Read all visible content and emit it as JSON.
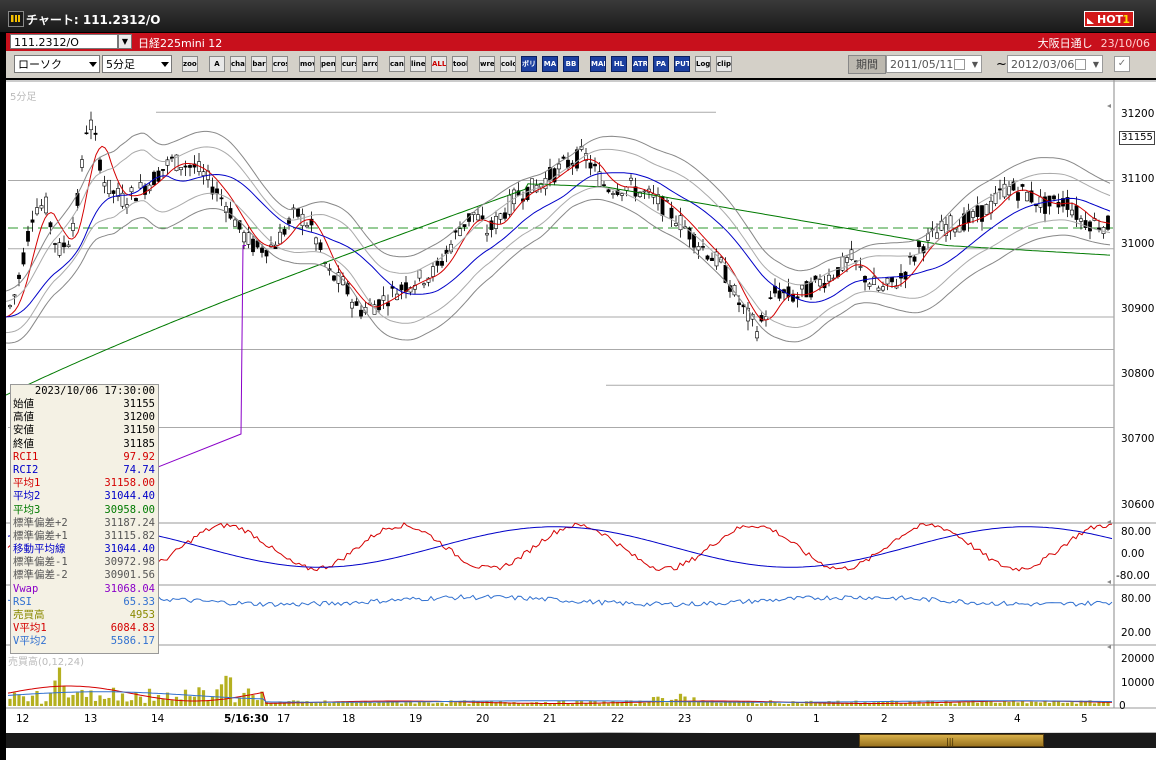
{
  "window": {
    "title": "チャート: 111.2312/O",
    "hot_label": "HOT",
    "hot_num": "1"
  },
  "symbol_bar": {
    "symbol": "111.2312/O",
    "name": "日経225mini 12",
    "exchange": "大阪日通し",
    "date": "23/10/06"
  },
  "toolbar": {
    "chart_type": "ローソク",
    "interval": "5分足",
    "buttons": [
      "zoom",
      "A",
      "chart",
      "bar",
      "cross",
      "move",
      "pen",
      "cursor",
      "arrow",
      "candle",
      "line",
      "ALL",
      "tool",
      "wrench",
      "color",
      "ボリ",
      "MA",
      "BB",
      "MAE",
      "HL",
      "ATR",
      "PA",
      "PUT",
      "Log",
      "clip"
    ],
    "period_label": "期間",
    "date_from": "2011/05/11",
    "date_to": "2012/03/06",
    "tilde": "~"
  },
  "chart": {
    "panel_label": "5分足",
    "volume_label": "売買高(0,12,24)",
    "current_price": "31155",
    "price_axis": [
      "31200",
      "31100",
      "31000",
      "30900",
      "30800",
      "30700",
      "30600"
    ],
    "osc_axis": [
      "80.00",
      "0.00",
      "-80.00"
    ],
    "rsi_axis": [
      "80.00",
      "20.00"
    ],
    "vol_axis": [
      "20000",
      "10000",
      "0"
    ],
    "x_labels": [
      "12",
      "13",
      "14",
      "5/16:30",
      "17",
      "18",
      "19",
      "20",
      "21",
      "22",
      "23",
      "0",
      "1",
      "2",
      "3",
      "4",
      "5"
    ]
  },
  "info": {
    "datetime": "2023/10/06  17:30:00",
    "rows": [
      {
        "label": "始値",
        "value": "31155",
        "color": "#000000"
      },
      {
        "label": "高値",
        "value": "31200",
        "color": "#000000"
      },
      {
        "label": "安値",
        "value": "31150",
        "color": "#000000"
      },
      {
        "label": "終値",
        "value": "31185",
        "color": "#000000"
      },
      {
        "label": "RCI1",
        "value": "97.92",
        "color": "#d40000"
      },
      {
        "label": "RCI2",
        "value": "74.74",
        "color": "#0000c8"
      },
      {
        "label": "平均1",
        "value": "31158.00",
        "color": "#d40000"
      },
      {
        "label": "平均2",
        "value": "31044.40",
        "color": "#0000c8"
      },
      {
        "label": "平均3",
        "value": "30958.00",
        "color": "#007a00"
      },
      {
        "label": "標準偏差+2",
        "value": "31187.24",
        "color": "#555555"
      },
      {
        "label": "標準偏差+1",
        "value": "31115.82",
        "color": "#555555"
      },
      {
        "label": "移動平均線",
        "value": "31044.40",
        "color": "#0000c8"
      },
      {
        "label": "標準偏差-1",
        "value": "30972.98",
        "color": "#555555"
      },
      {
        "label": "標準偏差-2",
        "value": "30901.56",
        "color": "#555555"
      },
      {
        "label": "Vwap",
        "value": "31068.04",
        "color": "#8a00c8"
      },
      {
        "label": "RSI",
        "value": "65.33",
        "color": "#3070d0"
      },
      {
        "label": "売買高",
        "value": "4953",
        "color": "#8a8a00"
      },
      {
        "label": "V平均1",
        "value": "6084.83",
        "color": "#d40000"
      },
      {
        "label": "V平均2",
        "value": "5586.17",
        "color": "#3070d0"
      }
    ]
  },
  "colors": {
    "up": "#ffffff",
    "down": "#000000",
    "ma_short": "#d40000",
    "ma_mid": "#0000c8",
    "ma_long": "#007a00",
    "bb": "#555555",
    "vwap": "#8a00c8",
    "rsi": "#3070d0",
    "volume": "#b5b020",
    "dashed": "#2e9a2e"
  }
}
